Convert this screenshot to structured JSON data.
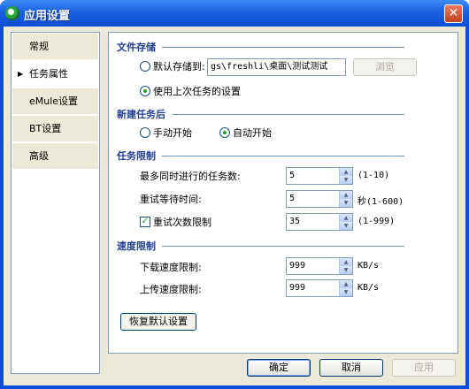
{
  "window": {
    "title": "应用设置",
    "close_glyph": "✕"
  },
  "nav": {
    "items": [
      {
        "label": "常规"
      },
      {
        "label": "任务属性",
        "active": true
      },
      {
        "label": "eMule设置"
      },
      {
        "label": "BT设置"
      },
      {
        "label": "高级"
      }
    ]
  },
  "file_storage": {
    "title": "文件存储",
    "default_label": "默认存储到:",
    "path_value": "gs\\freshli\\桌面\\测试测试",
    "browse_label": "浏览",
    "use_last_label": "使用上次任务的设置",
    "selected": "use_last"
  },
  "new_task": {
    "title": "新建任务后",
    "manual_label": "手动开始",
    "auto_label": "自动开始",
    "selected": "auto"
  },
  "task_limits": {
    "title": "任务限制",
    "max_tasks_label": "最多同时进行的任务数:",
    "max_tasks_value": "5",
    "max_tasks_hint": "(1-10)",
    "retry_wait_label": "重试等待时间:",
    "retry_wait_value": "5",
    "retry_wait_hint": "秒(1-600)",
    "retry_count_label": "重试次数限制",
    "retry_count_checked": true,
    "retry_count_value": "35",
    "retry_count_hint": "(1-999)"
  },
  "speed_limits": {
    "title": "速度限制",
    "download_label": "下载速度限制:",
    "download_value": "999",
    "download_unit": "KB/s",
    "upload_label": "上传速度限制:",
    "upload_value": "999",
    "upload_unit": "KB/s"
  },
  "restore_label": "恢复默认设置",
  "footer": {
    "ok": "确定",
    "cancel": "取消",
    "apply": "应用"
  },
  "colors": {
    "titlebar": "#0d4fd6",
    "section_title": "#213e95",
    "check_green": "#21a121",
    "dialog_bg": "#ece9d8"
  },
  "icons": {
    "app": "app-logo-icon",
    "spin_up": "▲",
    "spin_down": "▼",
    "check": "✓",
    "arrow": "▶"
  }
}
